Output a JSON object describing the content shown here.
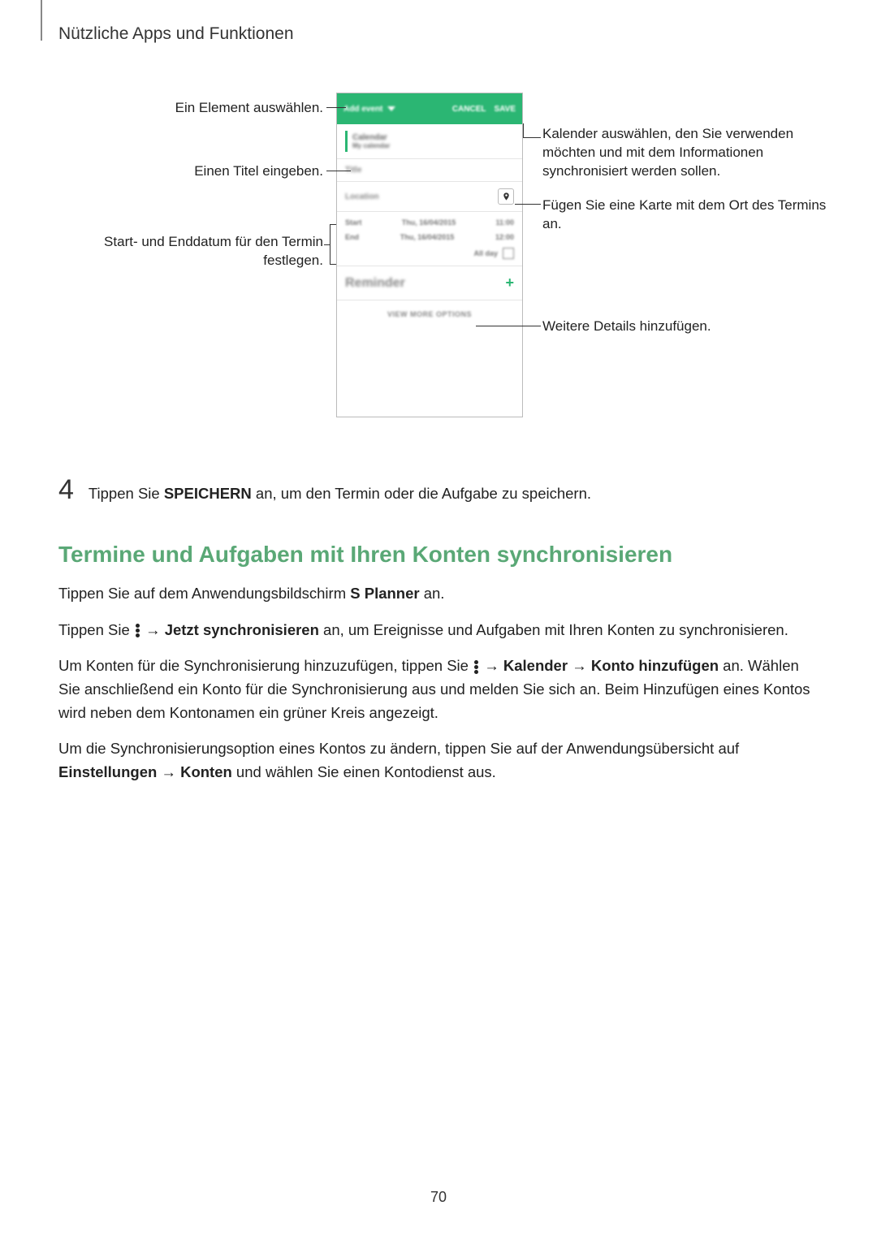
{
  "header": {
    "title": "Nützliche Apps und Funktionen"
  },
  "diagram": {
    "callouts": {
      "select_element": "Ein Element auswählen.",
      "enter_title": "Einen Titel eingeben.",
      "set_dates": "Start- und Enddatum für den Termin festlegen.",
      "choose_calendar": "Kalender auswählen, den Sie verwenden möchten und mit dem Informationen synchronisiert werden sollen.",
      "add_map": "Fügen Sie eine Karte mit dem Ort des Termins an.",
      "more_details": "Weitere Details hinzufügen."
    },
    "phone": {
      "topbar": {
        "add_event": "Add event",
        "cancel": "CANCEL",
        "save": "SAVE"
      },
      "calendar_label": "Calendar",
      "calendar_sub": "My calendar",
      "title_placeholder": "Title",
      "location_placeholder": "Location",
      "start_label": "Start",
      "end_label": "End",
      "date_text": "Thu, 16/04/2015",
      "start_time": "11:00",
      "end_time": "12:00",
      "all_day": "All day",
      "reminder": "Reminder",
      "view_more": "VIEW MORE OPTIONS"
    }
  },
  "step4": {
    "number": "4",
    "pre": "Tippen Sie ",
    "bold": "SPEICHERN",
    "post": " an, um den Termin oder die Aufgabe zu speichern."
  },
  "section": {
    "title": "Termine und Aufgaben mit Ihren Konten synchronisieren",
    "p1": {
      "pre": "Tippen Sie auf dem Anwendungsbildschirm ",
      "b": "S Planner",
      "post": " an."
    },
    "p2": {
      "pre": "Tippen Sie ",
      "arrow1": " → ",
      "b1": "Jetzt synchronisieren",
      "post": " an, um Ereignisse und Aufgaben mit Ihren Konten zu synchronisieren."
    },
    "p3": {
      "pre": "Um Konten für die Synchronisierung hinzuzufügen, tippen Sie ",
      "arrow1": " → ",
      "b1": "Kalender",
      "arrow2": " → ",
      "b2": "Konto hinzufügen",
      "post": " an. Wählen Sie anschließend ein Konto für die Synchronisierung aus und melden Sie sich an. Beim Hinzufügen eines Kontos wird neben dem Kontonamen ein grüner Kreis angezeigt."
    },
    "p4": {
      "pre": "Um die Synchronisierungsoption eines Kontos zu ändern, tippen Sie auf der Anwendungsübersicht auf ",
      "b1": "Einstellungen",
      "arrow": " → ",
      "b2": "Konten",
      "post": " und wählen Sie einen Kontodienst aus."
    }
  },
  "page_number": "70"
}
